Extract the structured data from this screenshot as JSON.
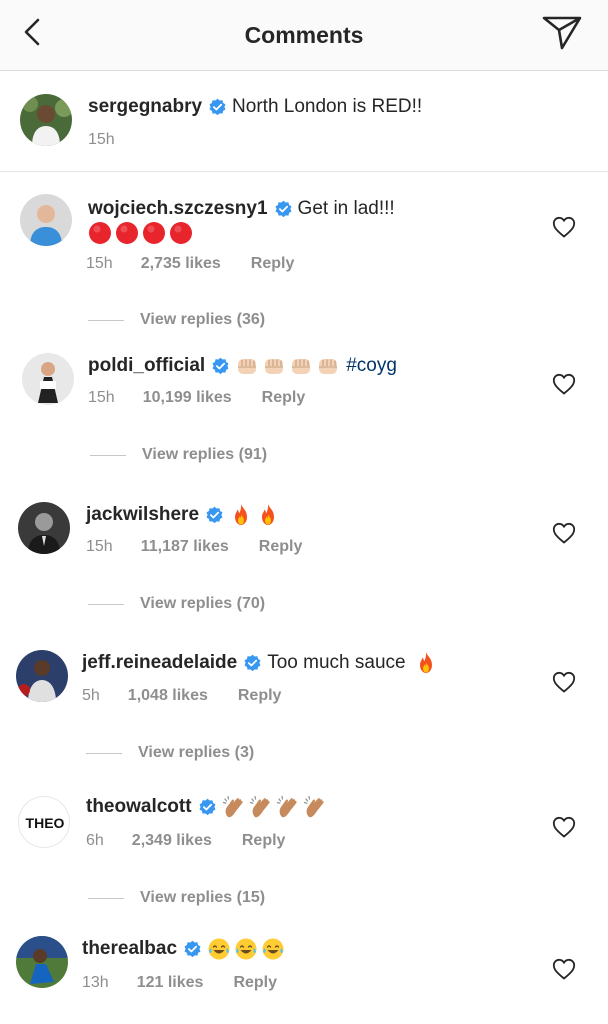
{
  "header": {
    "title": "Comments",
    "back_icon": "back-chevron-icon",
    "send_icon": "direct-send-icon"
  },
  "caption": {
    "username": "sergegnabry",
    "verified": true,
    "text": "North London is RED!!",
    "time": "15h"
  },
  "comments": [
    {
      "username": "wojciech.szczesny1",
      "text": "Get in lad!!!",
      "second_line_emoji": [
        "red-circle",
        "red-circle",
        "red-circle",
        "red-circle"
      ],
      "time": "15h",
      "likes": "2,735 likes",
      "reply": "Reply",
      "view_replies": "View replies (36)"
    },
    {
      "username": "poldi_official",
      "emoji": [
        "fist",
        "fist",
        "fist",
        "fist"
      ],
      "text": "#coyg",
      "time": "15h",
      "likes": "10,199 likes",
      "reply": "Reply",
      "view_replies": "View replies (91)"
    },
    {
      "username": "jackwilshere",
      "emoji": [
        "fire",
        "fire"
      ],
      "text": "",
      "time": "15h",
      "likes": "11,187 likes",
      "reply": "Reply",
      "view_replies": "View replies (70)"
    },
    {
      "username": "jeff.reineadelaide",
      "text": "Too much sauce",
      "emoji_after": [
        "fire"
      ],
      "time": "5h",
      "likes": "1,048 likes",
      "reply": "Reply",
      "view_replies": "View replies (3)"
    },
    {
      "username": "theowalcott",
      "avatar_text": "THEO",
      "emoji": [
        "clap",
        "clap",
        "clap",
        "clap"
      ],
      "text": "",
      "time": "6h",
      "likes": "2,349 likes",
      "reply": "Reply",
      "view_replies": "View replies (15)"
    },
    {
      "username": "therealbac",
      "emoji": [
        "joy",
        "joy",
        "joy"
      ],
      "text": "",
      "time": "13h",
      "likes": "121 likes",
      "reply": "Reply"
    }
  ],
  "colors": {
    "verified_blue": "#3897f0",
    "meta_gray": "#8e8e8e",
    "text": "#262626",
    "hashtag": "#003569"
  }
}
